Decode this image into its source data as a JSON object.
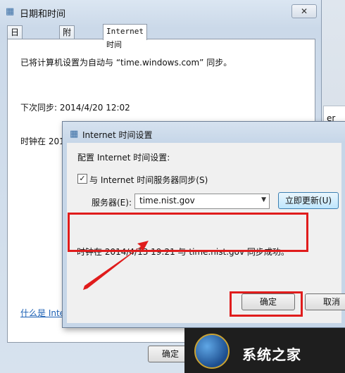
{
  "main_window": {
    "title": "日期和时间",
    "close_label": "✕",
    "tabs": [
      "日期和时间",
      "附加时钟",
      "Internet 时间"
    ],
    "panel": {
      "auto_sync_text": "已将计算机设置为自动与 “time.windows.com” 同步。",
      "next_sync_text": "下次同步: 2014/4/20 12:02",
      "clock_partial_text": "时钟在 201",
      "link_text": "什么是 Inte"
    },
    "ok_label": "确定"
  },
  "background_window": {
    "fragment_1": "er",
    "fragment_2": "."
  },
  "dialog": {
    "title": "Internet 时间设置",
    "config_label": "配置 Internet 时间设置:",
    "sync_checkbox_label": "与 Internet 时间服务器同步(S)",
    "sync_checked": true,
    "server_label": "服务器(E):",
    "server_value": "time.nist.gov",
    "update_button": "立即更新(U)",
    "status_message": "时钟在 2014/4/13 19:21 与 time.nist.gov 同步成功。",
    "ok_label": "确定",
    "cancel_label": "取消"
  },
  "watermark": {
    "brand_text": "系统之家"
  },
  "colors": {
    "highlight_red": "#e01c1c",
    "link_blue": "#1a5fb4"
  }
}
